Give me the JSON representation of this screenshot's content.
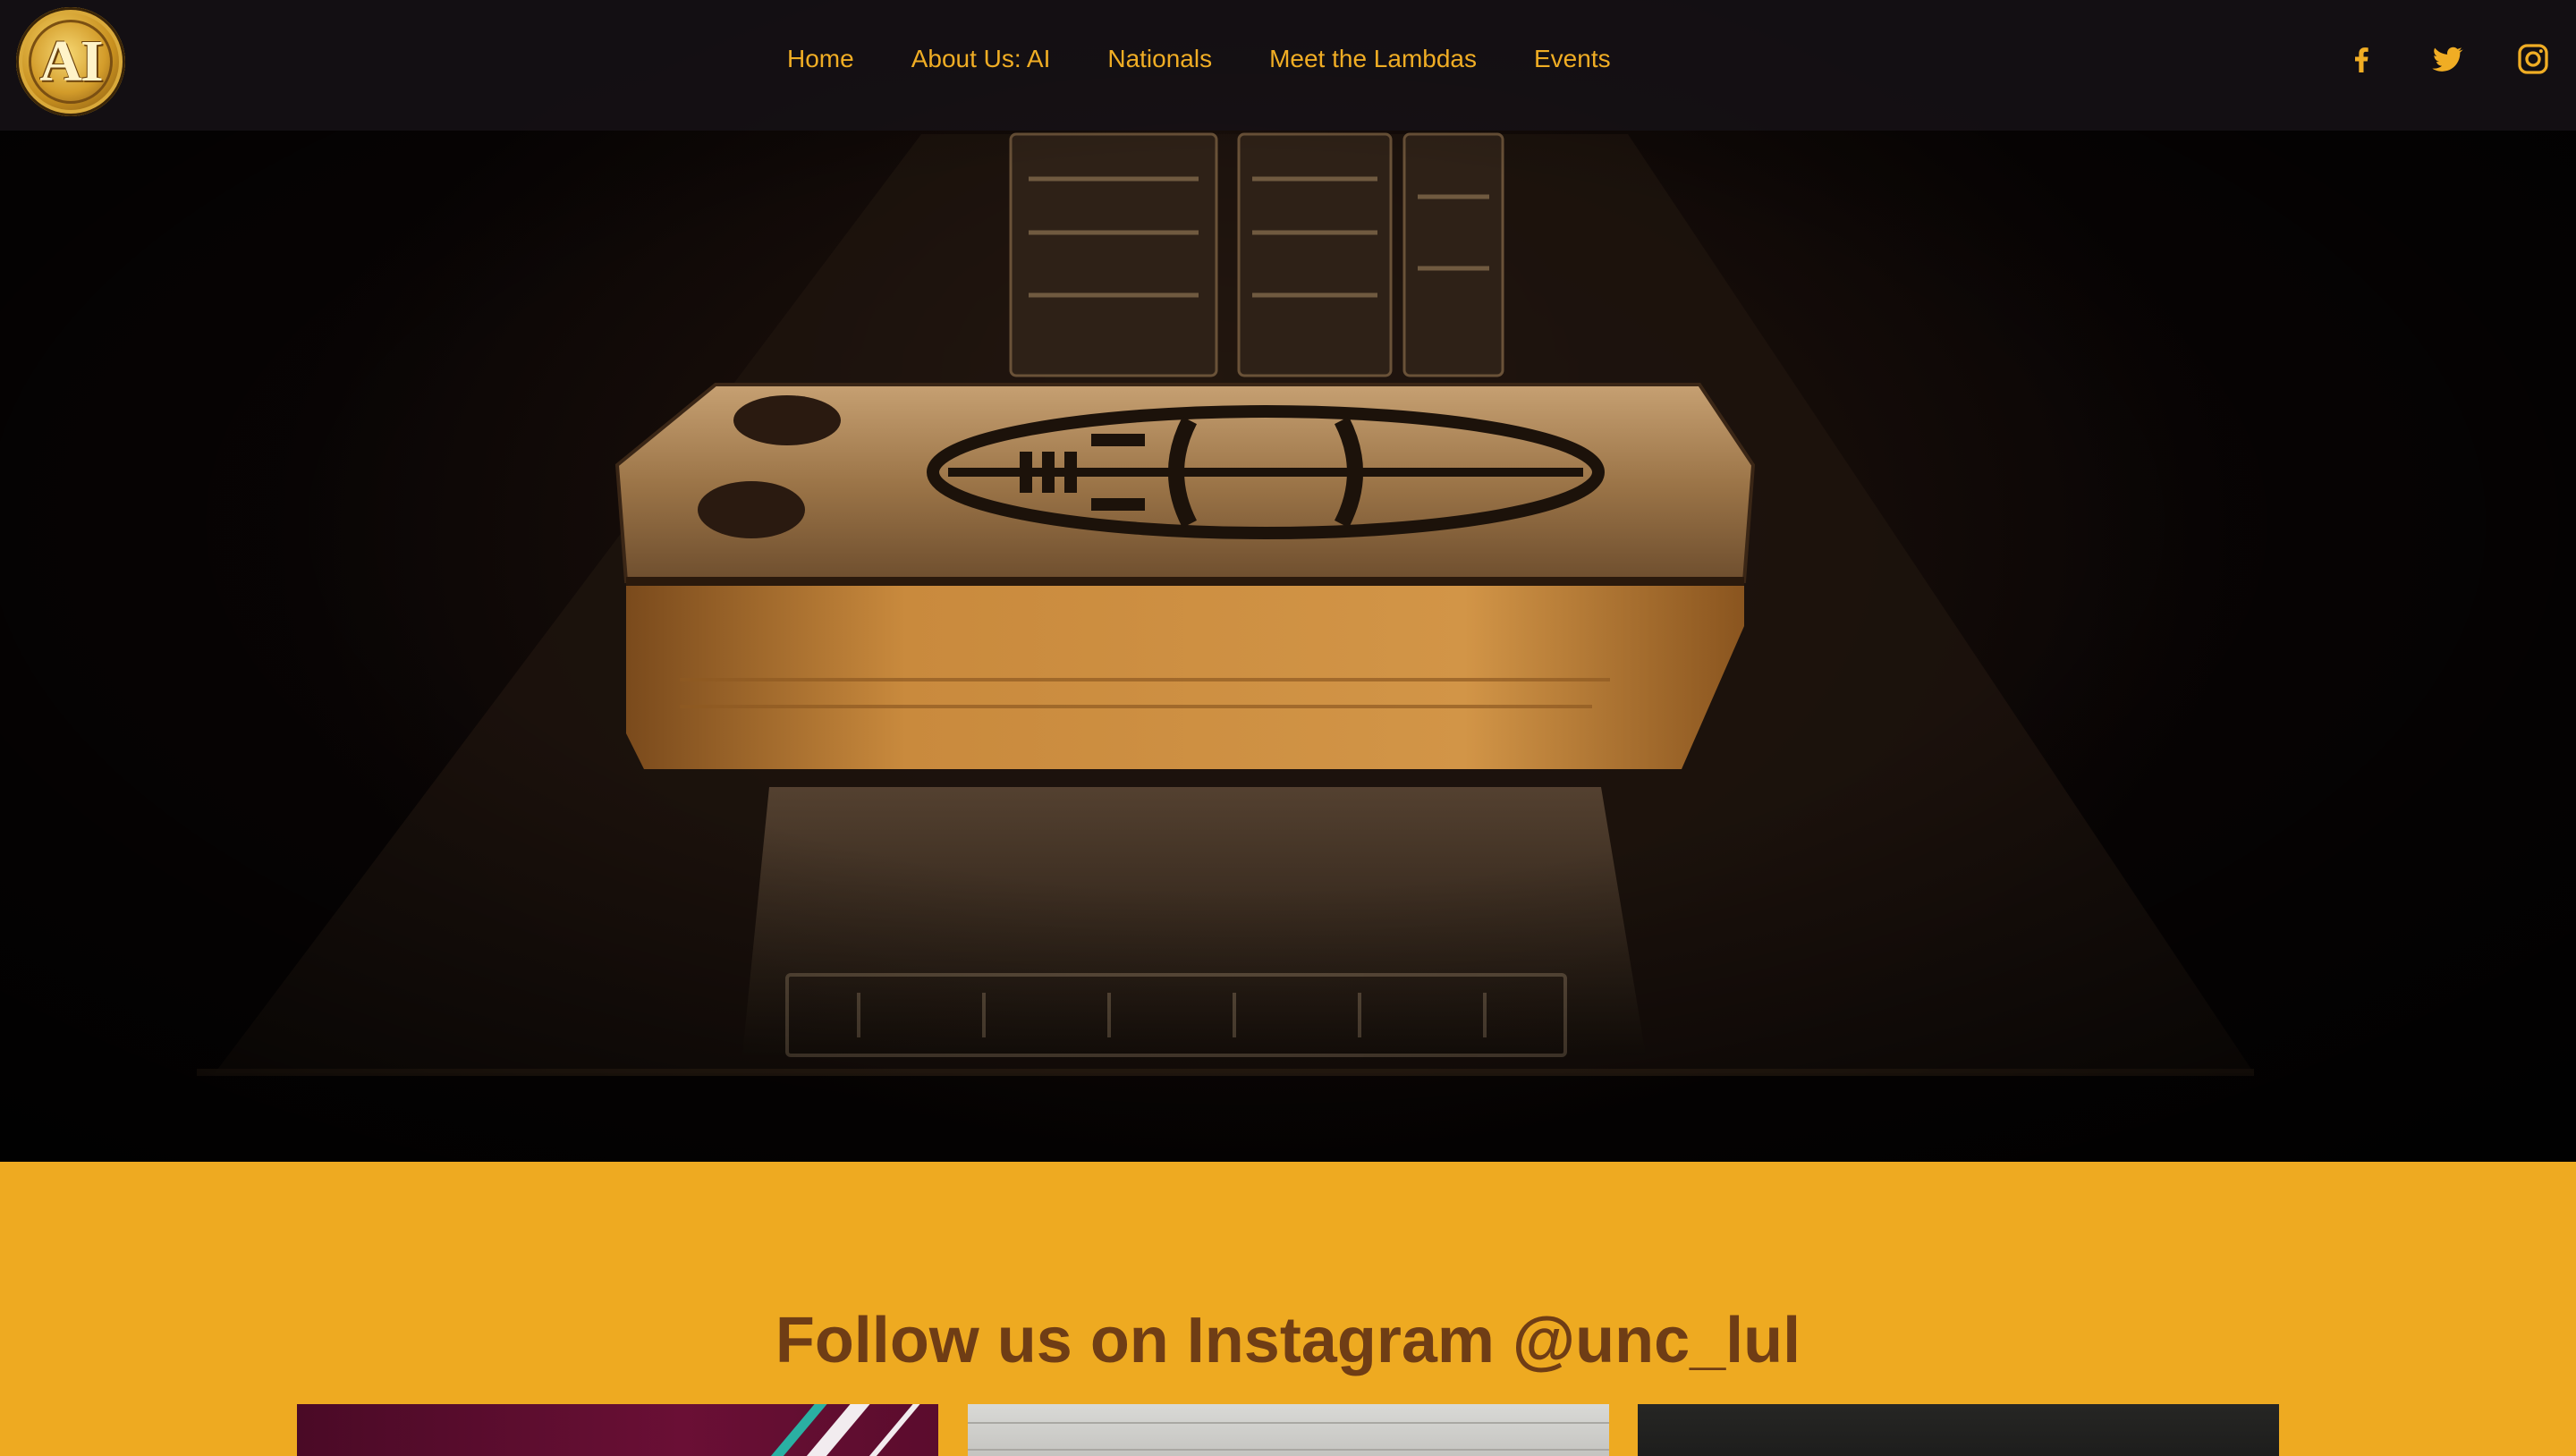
{
  "logo": {
    "text": "AI"
  },
  "nav": {
    "links": [
      {
        "label": "Home"
      },
      {
        "label": "About Us: AI"
      },
      {
        "label": "Nationals"
      },
      {
        "label": "Meet the Lambdas"
      },
      {
        "label": "Events"
      }
    ]
  },
  "social": [
    {
      "icon": "facebook-icon"
    },
    {
      "icon": "twitter-icon"
    },
    {
      "icon": "instagram-icon"
    }
  ],
  "instagram": {
    "title": "Follow us on Instagram @unc_lul"
  },
  "colors": {
    "nav_text": "#f0ad24",
    "section_bg": "#eeaa21",
    "title_text": "#6f3d15",
    "nav_bg": "#161216"
  }
}
